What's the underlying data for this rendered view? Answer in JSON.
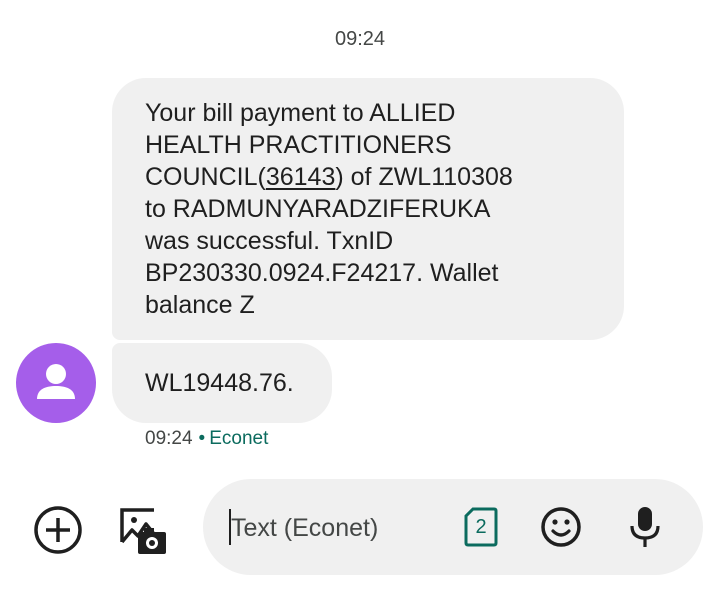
{
  "conversation": {
    "date_header": "09:24",
    "messages": [
      {
        "lines": [
          "Your bill payment to ALLIED",
          "HEALTH PRACTITIONERS",
          [
            "COUNCIL(",
            "36143",
            ") of ZWL110308"
          ],
          "to RADMUNYARADZIFERUKA",
          "was successful. TxnID",
          "BP230330.0924.F24217. Wallet",
          "balance Z"
        ]
      },
      {
        "lines": [
          "WL19448.76."
        ]
      }
    ],
    "meta": {
      "time": "09:24",
      "separator": "•",
      "carrier": "Econet"
    },
    "avatar_color": "#a55eea"
  },
  "compose": {
    "placeholder": "Text (Econet)",
    "sim_slot": "2",
    "icons": [
      "add-icon",
      "gallery-icon",
      "sim-card-icon",
      "emoji-icon",
      "mic-icon"
    ]
  }
}
